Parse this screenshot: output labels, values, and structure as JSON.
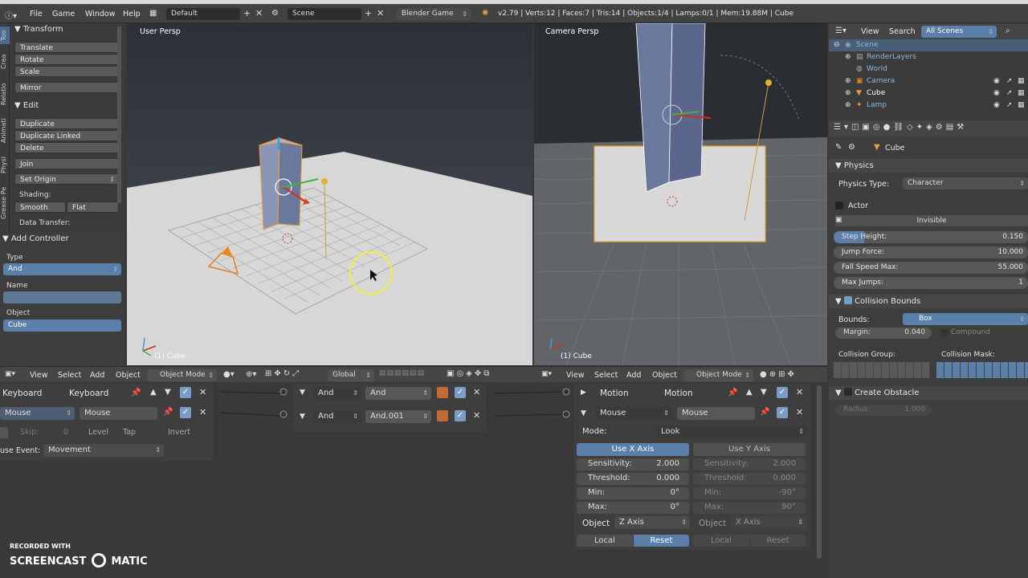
{
  "window": {
    "title_bar": "Blender"
  },
  "topbar": {
    "menus": [
      "File",
      "Game",
      "Window",
      "Help"
    ],
    "layout": "Default",
    "scene": "Scene",
    "engine": "Blender Game",
    "stats": "v2.79 | Verts:12 | Faces:7 | Tris:14 | Objects:1/4 | Lamps:0/1 | Mem:19.88M | Cube"
  },
  "tool_tabs": [
    "Too",
    "Crea",
    "Relatio",
    "Animati",
    "Physi",
    "Grease Pe"
  ],
  "tool_shelf": {
    "transform_header": "Transform",
    "translate": "Translate",
    "rotate": "Rotate",
    "scale": "Scale",
    "mirror": "Mirror",
    "edit_header": "Edit",
    "duplicate": "Duplicate",
    "duplicate_linked": "Duplicate Linked",
    "delete": "Delete",
    "join": "Join",
    "set_origin": "Set Origin",
    "shading_label": "Shading:",
    "smooth": "Smooth",
    "flat": "Flat",
    "data_transfer": "Data Transfer:"
  },
  "add_controller": {
    "header": "Add Controller",
    "type_label": "Type",
    "type_value": "And",
    "name_label": "Name",
    "object_label": "Object",
    "object_value": "Cube"
  },
  "viewport_left": {
    "label": "User Persp",
    "footer": "(1) Cube"
  },
  "viewport_right": {
    "label": "Camera Persp",
    "footer": "(1) Cube"
  },
  "viewport_header": {
    "left": {
      "menus": [
        "View",
        "Select",
        "Add",
        "Object"
      ],
      "mode": "Object Mode",
      "orientation": "Global"
    },
    "right": {
      "menus": [
        "View",
        "Select",
        "Add",
        "Object"
      ],
      "mode": "Object Mode"
    }
  },
  "sensors": {
    "keyboard_type": "Keyboard",
    "keyboard_name": "Keyboard",
    "mouse_type": "Mouse",
    "mouse_name": "Mouse",
    "skip_label": "Skip:",
    "skip_value": "0",
    "level": "Level",
    "tap": "Tap",
    "invert": "Invert",
    "use_event_label": "use Event:",
    "use_event_value": "Movement"
  },
  "controllers": {
    "c1_type": "And",
    "c1_name": "And",
    "c2_type": "And",
    "c2_name": "And.001"
  },
  "actuators": {
    "motion_type": "Motion",
    "motion_name": "Motion",
    "mouse_type": "Mouse",
    "mouse_name": "Mouse",
    "mode_label": "Mode:",
    "mode_value": "Look",
    "use_x": "Use X Axis",
    "use_y": "Use Y Axis",
    "x_sensitivity_label": "Sensitivity:",
    "x_sensitivity": "2.000",
    "x_threshold_label": "Threshold:",
    "x_threshold": "0.000",
    "x_min_label": "Min:",
    "x_min": "0°",
    "x_max_label": "Max:",
    "x_max": "0°",
    "y_sensitivity_label": "Sensitivity:",
    "y_sensitivity": "2.000",
    "y_threshold_label": "Threshold:",
    "y_threshold": "0.000",
    "y_min_label": "Min:",
    "y_min": "-90°",
    "y_max_label": "Max:",
    "y_max": "90°",
    "x_object_label": "Object",
    "x_object_value": "Z Axis",
    "y_object_label": "Object",
    "y_object_value": "X Axis",
    "local": "Local",
    "reset": "Reset",
    "local2": "Local",
    "reset2": "Reset"
  },
  "outliner": {
    "view": "View",
    "search": "Search",
    "filter": "All Scenes",
    "rows": [
      "Scene",
      "RenderLayers",
      "World",
      "Camera",
      "Cube",
      "Lamp"
    ]
  },
  "properties": {
    "object_name": "Cube",
    "physics_header": "Physics",
    "physics_type_label": "Physics Type:",
    "physics_type_value": "Character",
    "actor": "Actor",
    "invisible": "Invisible",
    "step_height_label": "Step Height:",
    "step_height": "0.150",
    "jump_force_label": "Jump Force:",
    "jump_force": "10.000",
    "fall_speed_label": "Fall Speed Max:",
    "fall_speed": "55.000",
    "max_jumps_label": "Max Jumps:",
    "max_jumps": "1",
    "collision_bounds_header": "Collision Bounds",
    "bounds_label": "Bounds:",
    "bounds_value": "Box",
    "margin_label": "Margin:",
    "margin_value": "0.040",
    "compound": "Compound",
    "collision_group": "Collision Group:",
    "collision_mask": "Collision Mask:",
    "create_obstacle": "Create Obstacle",
    "radius_label": "Radius:",
    "radius_value": "1.000"
  },
  "watermark": {
    "line1": "RECORDED WITH",
    "line2": "SCREENCAST",
    "line3": "MATIC"
  },
  "colors": {
    "accent": "#5a7fa8",
    "selected_outline": "#f0a030"
  }
}
